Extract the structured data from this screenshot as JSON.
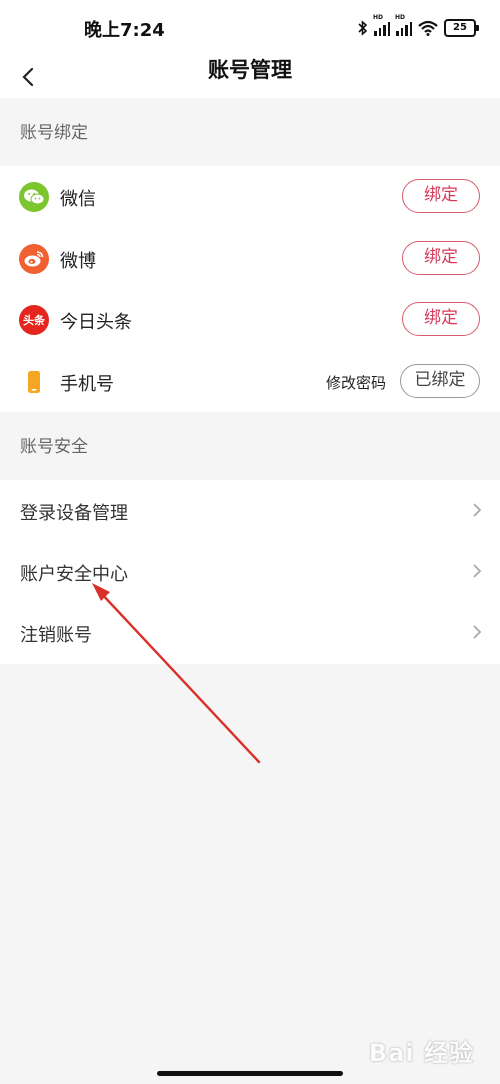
{
  "status": {
    "time": "晚上7:24",
    "hd_label": "HD",
    "battery": "25"
  },
  "nav": {
    "title": "账号管理"
  },
  "sections": {
    "binding_header": "账号绑定",
    "security_header": "账号安全"
  },
  "binding": {
    "wechat": {
      "label": "微信",
      "button": "绑定"
    },
    "weibo": {
      "label": "微博",
      "button": "绑定"
    },
    "toutiao": {
      "label": "今日头条",
      "icon_text": "头条",
      "button": "绑定"
    },
    "phone": {
      "label": "手机号",
      "change_password": "修改密码",
      "button": "已绑定"
    }
  },
  "security": {
    "items": [
      {
        "label": "登录设备管理"
      },
      {
        "label": "账户安全中心"
      },
      {
        "label": "注销账号"
      }
    ]
  },
  "watermark": "Bai 经验",
  "colors": {
    "accent": "#d63a5a",
    "wechat": "#7bc62f",
    "weibo": "#f06030",
    "toutiao": "#e5261f",
    "phone": "#f5a623",
    "annotation": "#d9302a"
  }
}
